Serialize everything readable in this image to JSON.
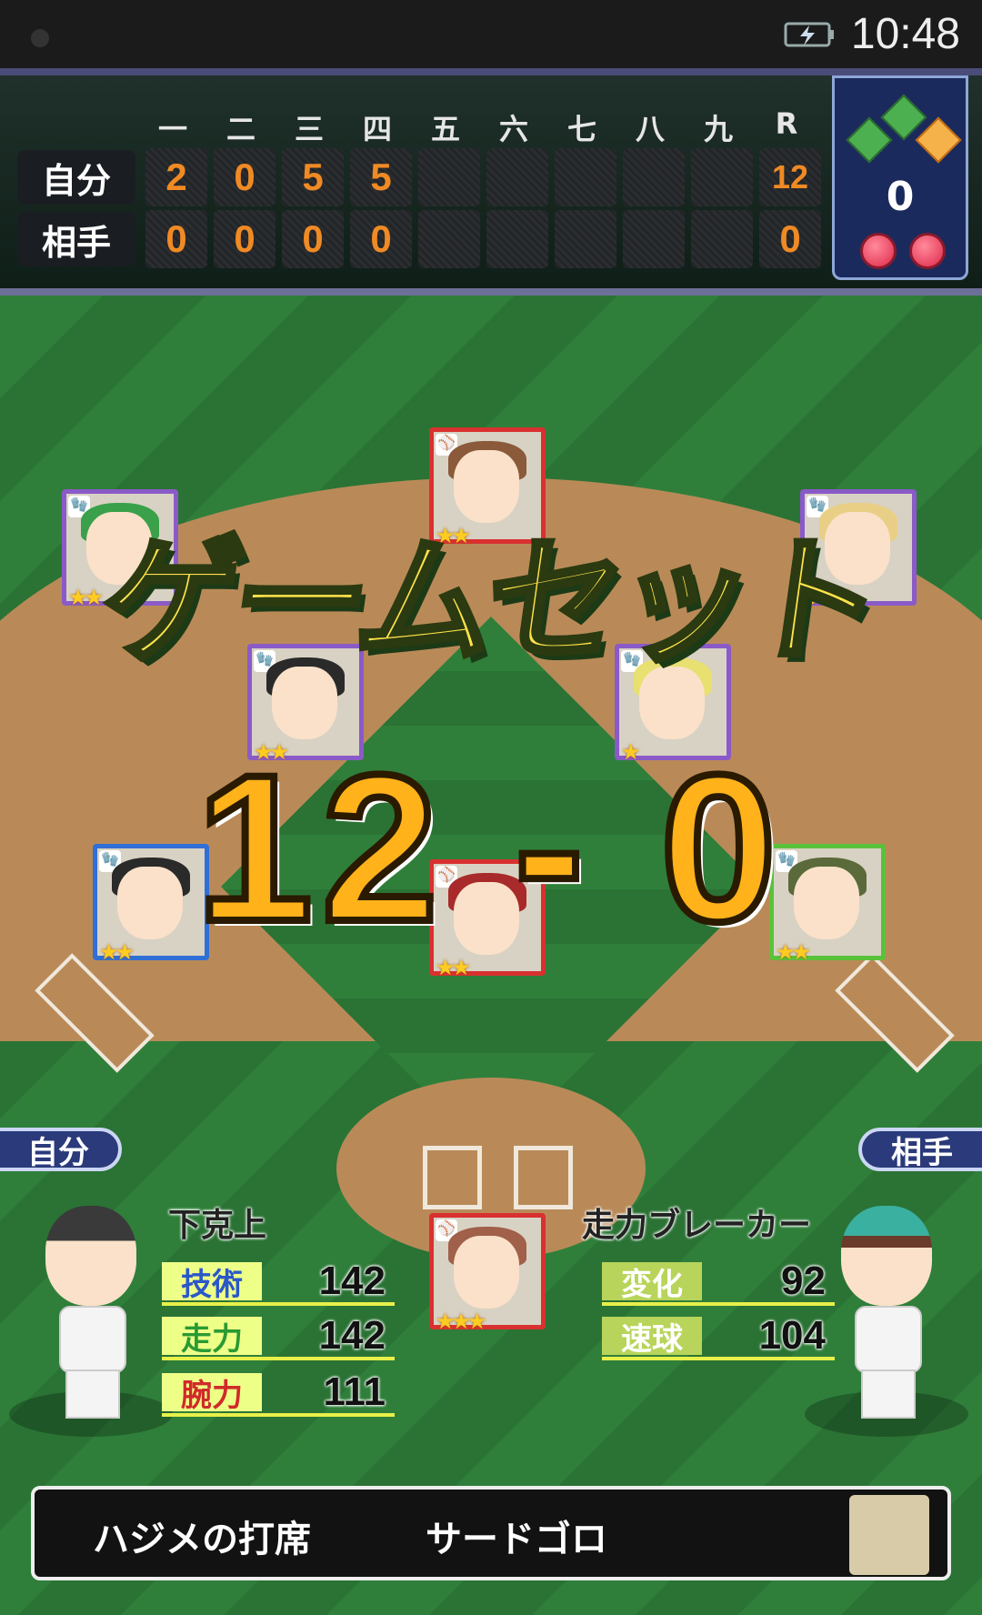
{
  "status_bar": {
    "time": "10:48"
  },
  "scoreboard": {
    "innings": [
      "一",
      "二",
      "三",
      "四",
      "五",
      "六",
      "七",
      "八",
      "九",
      "R"
    ],
    "rows": [
      {
        "team": "自分",
        "scores": [
          "2",
          "0",
          "5",
          "5",
          "",
          "",
          "",
          "",
          "",
          "12"
        ]
      },
      {
        "team": "相手",
        "scores": [
          "0",
          "0",
          "0",
          "0",
          "",
          "",
          "",
          "",
          "",
          "0"
        ]
      }
    ],
    "outs": "0"
  },
  "overlay": {
    "game_set": "ゲームセット",
    "final_score": "12 - 0"
  },
  "my_side": {
    "tag": "自分",
    "player_name": "下克上",
    "stats": [
      {
        "label": "技術",
        "value": "142",
        "color": "#2b57c9"
      },
      {
        "label": "走力",
        "value": "142",
        "color": "#2a9a33"
      },
      {
        "label": "腕力",
        "value": "111",
        "color": "#d02a2a"
      }
    ]
  },
  "opponent_side": {
    "tag": "相手",
    "player_name": "走力ブレーカー",
    "stats": [
      {
        "label": "変化",
        "value": "92"
      },
      {
        "label": "速球",
        "value": "104"
      }
    ]
  },
  "message": {
    "left": "ハジメの打席",
    "right": "サードゴロ"
  },
  "colors": {
    "card_red": "#d93030",
    "card_purple": "#8a5ac8",
    "card_blue": "#2f6fd6",
    "card_green": "#5ac23a",
    "score_orange": "#f08a24"
  }
}
